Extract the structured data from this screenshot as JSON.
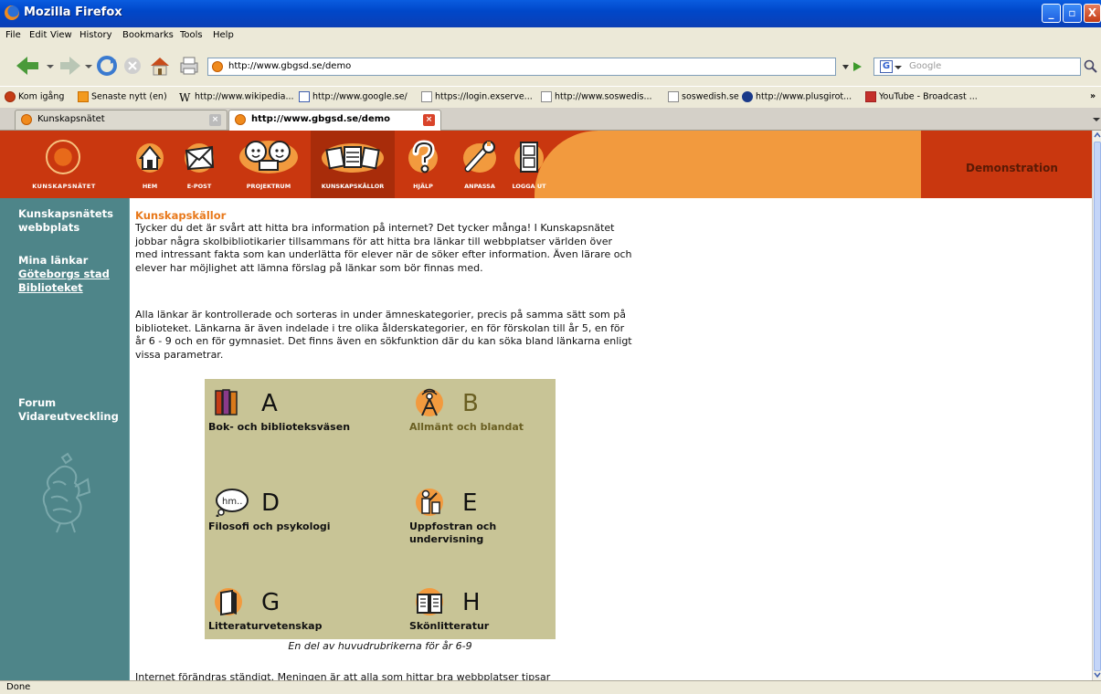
{
  "window": {
    "title": "Mozilla Firefox",
    "min_label": "_",
    "max_label": "▫",
    "close_label": "X"
  },
  "menu": [
    "File",
    "Edit",
    "View",
    "History",
    "Bookmarks",
    "Tools",
    "Help"
  ],
  "nav": {
    "url": "http://www.gbgsd.se/demo",
    "search_placeholder": "Google",
    "search_engine_icon": "G"
  },
  "bookmarks": [
    "Kom igång",
    "Senaste nytt (en)",
    "http://www.wikipedia...",
    "http://www.google.se/",
    "https://login.exserve...",
    "http://www.soswedis...",
    "soswedish.se",
    "http://www.plusgirot...",
    "YouTube - Broadcast ..."
  ],
  "bookmarks_overflow": "»",
  "tabs": [
    {
      "label": "Kunskapsnätet",
      "active": false
    },
    {
      "label": "http://www.gbgsd.se/demo",
      "active": true
    }
  ],
  "site": {
    "logo_caption": "KUNSKAPSNÄTET",
    "nav": [
      "HEM",
      "E-POST",
      "PROJEKTRUM",
      "KUNSKAPSKÄLLOR",
      "HJÄLP",
      "ANPASSA",
      "LOGGA UT"
    ],
    "demo_label": "Demonstration"
  },
  "sidebar": {
    "site_link": "Kunskapsnätets webbplats",
    "my_links_heading": "Mina länkar",
    "link_city": "Göteborgs stad",
    "link_library": "Biblioteket",
    "forum": "Forum",
    "forum_sub": "Vidareutveckling"
  },
  "content": {
    "heading": "Kunskapskällor",
    "p1": "Tycker du det är svårt att hitta bra information på internet? Det tycker många! I Kunskapsnätet jobbar några skolbibliotikarier tillsammans för att hitta bra länkar till webbplatser världen över med intressant fakta som kan underlätta för elever när de söker efter information. Även lärare och elever har möjlighet att lämna förslag på länkar som bör finnas med.",
    "p2": "Alla länkar är kontrollerade och sorteras in under ämneskategorier, precis på samma sätt som på biblioteket. Länkarna är även indelade i tre olika ålderskategorier, en för förskolan till år 5, en för år 6 - 9 och en för gymnasiet. Det finns även en sökfunktion där du kan söka bland länkarna enligt vissa parametrar.",
    "categories": [
      {
        "letter": "A",
        "name": "Bok- och biblioteksväsen",
        "icon": "books-icon"
      },
      {
        "letter": "B",
        "name": "Allmänt och blandat",
        "icon": "antenna-icon"
      },
      {
        "letter": "D",
        "name": "Filosofi och psykologi",
        "icon": "thought-bubble-icon"
      },
      {
        "letter": "E",
        "name": "Uppfostran och undervisning",
        "icon": "teacher-icon"
      },
      {
        "letter": "G",
        "name": "Litteraturvetenskap",
        "icon": "book-open-icon"
      },
      {
        "letter": "H",
        "name": "Skönlitteratur",
        "icon": "open-book-icon"
      }
    ],
    "caption": "En del av huvudrubrikerna för år 6-9",
    "p3": "Internet förändras ständigt. Meningen är att alla som hittar bra webbplatser tipsar"
  },
  "status": "Done"
}
